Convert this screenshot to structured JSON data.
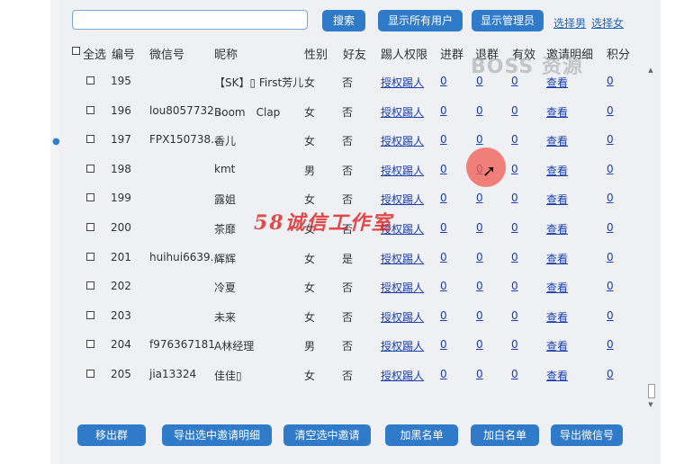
{
  "toolbar": {
    "search_placeholder": "",
    "search_button": "搜索",
    "show_all_users": "显示所有用户",
    "show_admins": "显示管理员",
    "select_male": "选择男",
    "select_female": "选择女"
  },
  "headers": {
    "select_all": "全选",
    "id": "编号",
    "wechat": "微信号",
    "nickname": "昵称",
    "gender": "性别",
    "friend": "好友",
    "kick_permission": "踢人权限",
    "joined": "进群",
    "left": "退群",
    "valid": "有效",
    "invite_details": "邀请明细",
    "points": "积分"
  },
  "rows": [
    {
      "id": "195",
      "wechat": "",
      "nickname": "【SK】▯ First芳儿",
      "gender": "女",
      "friend": "否",
      "perm": "授权踢人",
      "joined": "0",
      "left": "0",
      "valid": "0",
      "invite": "查看",
      "points": "0"
    },
    {
      "id": "196",
      "wechat": "lou8057732...",
      "nickname": "Boom　Clap",
      "gender": "女",
      "friend": "否",
      "perm": "授权踢人",
      "joined": "0",
      "left": "0",
      "valid": "0",
      "invite": "查看",
      "points": "0"
    },
    {
      "id": "197",
      "wechat": "FPX150738...",
      "nickname": "香儿",
      "gender": "女",
      "friend": "否",
      "perm": "授权踢人",
      "joined": "0",
      "left": "0",
      "valid": "0",
      "invite": "查看",
      "points": "0"
    },
    {
      "id": "198",
      "wechat": "",
      "nickname": "kmt",
      "gender": "男",
      "friend": "否",
      "perm": "授权踢人",
      "joined": "0",
      "left": "0",
      "valid": "0",
      "invite": "查看",
      "points": "0"
    },
    {
      "id": "199",
      "wechat": "",
      "nickname": "露姐",
      "gender": "女",
      "friend": "否",
      "perm": "授权踢人",
      "joined": "0",
      "left": "0",
      "valid": "0",
      "invite": "查看",
      "points": "0"
    },
    {
      "id": "200",
      "wechat": "",
      "nickname": "茶靡",
      "gender": "女",
      "friend": "否",
      "perm": "授权踢人",
      "joined": "0",
      "left": "0",
      "valid": "0",
      "invite": "查看",
      "points": "0"
    },
    {
      "id": "201",
      "wechat": "huihui6639...",
      "nickname": "辉辉",
      "gender": "女",
      "friend": "是",
      "perm": "授权踢人",
      "joined": "0",
      "left": "0",
      "valid": "0",
      "invite": "查看",
      "points": "0"
    },
    {
      "id": "202",
      "wechat": "",
      "nickname": "冷夏",
      "gender": "女",
      "friend": "否",
      "perm": "授权踢人",
      "joined": "0",
      "left": "0",
      "valid": "0",
      "invite": "查看",
      "points": "0"
    },
    {
      "id": "203",
      "wechat": "",
      "nickname": "未来",
      "gender": "女",
      "friend": "否",
      "perm": "授权踢人",
      "joined": "0",
      "left": "0",
      "valid": "0",
      "invite": "查看",
      "points": "0"
    },
    {
      "id": "204",
      "wechat": "f976367181",
      "nickname": "A林经理",
      "gender": "男",
      "friend": "否",
      "perm": "授权踢人",
      "joined": "0",
      "left": "0",
      "valid": "0",
      "invite": "查看",
      "points": "0"
    },
    {
      "id": "205",
      "wechat": "jia13324",
      "nickname": "佳佳▯",
      "gender": "女",
      "friend": "否",
      "perm": "授权踢人",
      "joined": "0",
      "left": "0",
      "valid": "0",
      "invite": "查看",
      "points": "0"
    }
  ],
  "bottom": {
    "remove_from_group": "移出群",
    "export_invite_details": "导出选中邀请明细",
    "clear_selected_invites": "清空选中邀请",
    "add_blacklist": "加黑名单",
    "add_whitelist": "加白名单",
    "export_wechat": "导出微信号"
  },
  "watermarks": {
    "boss": "BOSS 资源",
    "studio": "58诚信工作室"
  },
  "colors": {
    "button": "#2f7ac9",
    "link": "#1b3fae",
    "panel": "#eef0f3"
  }
}
